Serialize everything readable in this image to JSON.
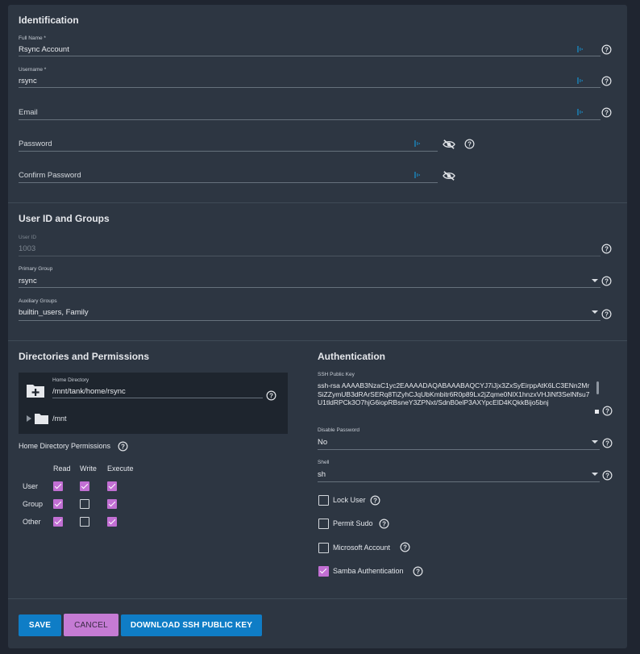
{
  "identification": {
    "title": "Identification",
    "full_name": {
      "label": "Full Name *",
      "value": "Rsync Account"
    },
    "username": {
      "label": "Username *",
      "value": "rsync"
    },
    "email": {
      "placeholder": "Email"
    },
    "password": {
      "placeholder": "Password"
    },
    "confirm_password": {
      "placeholder": "Confirm Password"
    }
  },
  "user_id_groups": {
    "title": "User ID and Groups",
    "user_id": {
      "label": "User ID",
      "value": "1003"
    },
    "primary_group": {
      "label": "Primary Group",
      "value": "rsync"
    },
    "auxiliary_groups": {
      "label": "Auxiliary Groups",
      "value": "builtin_users, Family"
    }
  },
  "directories": {
    "title": "Directories and Permissions",
    "home_directory": {
      "label": "Home Directory",
      "value": "/mnt/tank/home/rsync"
    },
    "tree_item": "/mnt",
    "permissions_label": "Home Directory Permissions",
    "columns": [
      "Read",
      "Write",
      "Execute"
    ],
    "rows": [
      {
        "name": "User",
        "read": true,
        "write": true,
        "execute": true
      },
      {
        "name": "Group",
        "read": true,
        "write": false,
        "execute": true
      },
      {
        "name": "Other",
        "read": true,
        "write": false,
        "execute": true
      }
    ]
  },
  "authentication": {
    "title": "Authentication",
    "ssh_key": {
      "label": "SSH Public Key",
      "value": "ssh-rsa AAAAB3NzaC1yc2EAAAADAQABAAABAQCYJ7iJjx3ZxSyEirppAtK6LC3ENn2MrSiZZymUB3dRArSERq8TiZyhCJqUbKmbitr6R0p89Lx2jZqme0NlX1hnzxVHJiNf3SelNfsu7U1tldRPCk3O7hjG6iopRBsneY3ZPNxt/SdnB0elP3AXYpcElD4KQkkBijo5bnj"
    },
    "disable_password": {
      "label": "Disable Password",
      "value": "No"
    },
    "shell": {
      "label": "Shell",
      "value": "sh"
    },
    "checkboxes": [
      {
        "label": "Lock User",
        "checked": false
      },
      {
        "label": "Permit Sudo",
        "checked": false
      },
      {
        "label": "Microsoft Account",
        "checked": false
      },
      {
        "label": "Samba Authentication",
        "checked": true
      }
    ]
  },
  "actions": {
    "save": "SAVE",
    "cancel": "CANCEL",
    "download": "DOWNLOAD SSH PUBLIC KEY"
  },
  "colors": {
    "accent_blue": "#0f7dc6",
    "accent_purple": "#c26fd3",
    "card_bg": "#2d3642"
  }
}
